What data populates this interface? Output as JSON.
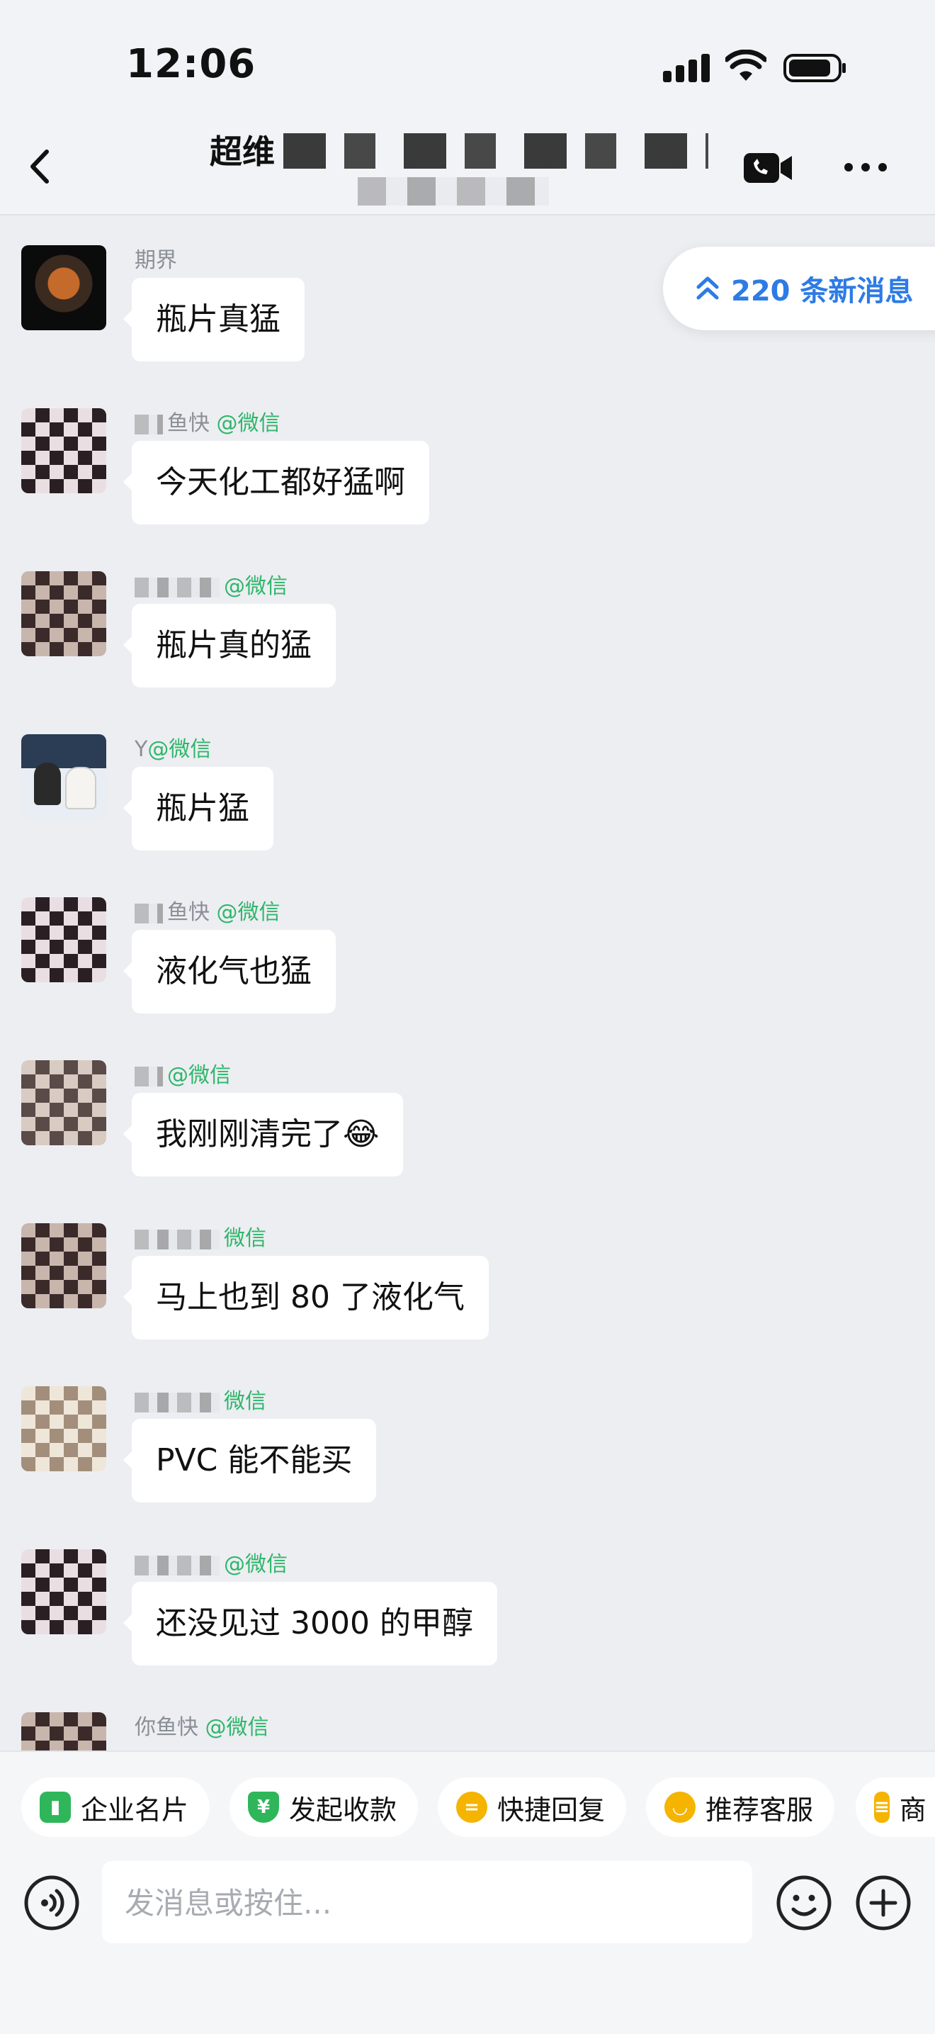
{
  "status_bar": {
    "time": "12:06"
  },
  "header": {
    "title_visible": "超维",
    "back_icon": "chevron-left-icon",
    "video_icon": "video-camera-icon",
    "more_icon": "more-dots-icon"
  },
  "new_messages": {
    "label": "220 条新消息",
    "icon": "double-chevron-up-icon"
  },
  "messages": [
    {
      "sender": "期界",
      "tag": "",
      "text": "瓶片真猛"
    },
    {
      "sender": "鱼快",
      "tag": "@微信",
      "text": "今天化工都好猛啊"
    },
    {
      "sender": "",
      "tag": "@微信",
      "text": "瓶片真的猛"
    },
    {
      "sender": "Y",
      "tag": "@微信",
      "text": "瓶片猛"
    },
    {
      "sender": "鱼快",
      "tag": "@微信",
      "text": "液化气也猛"
    },
    {
      "sender": "",
      "tag": "@微信",
      "text": "我刚刚清完了😂"
    },
    {
      "sender": "",
      "tag": "微信",
      "text": "马上也到 80 了液化气"
    },
    {
      "sender": "",
      "tag": "微信",
      "text": "PVC 能不能买"
    },
    {
      "sender": "",
      "tag": "@微信",
      "text": "还没见过 3000 的甲醇"
    },
    {
      "sender": "你鱼快",
      "tag": "@微信",
      "text": ""
    }
  ],
  "quick_actions": [
    {
      "label": "企业名片",
      "icon": "business-card-icon",
      "color": "#2fb65a"
    },
    {
      "label": "发起收款",
      "icon": "yuan-shield-icon",
      "color": "#2fb65a"
    },
    {
      "label": "快捷回复",
      "icon": "quick-reply-icon",
      "color": "#f5b400"
    },
    {
      "label": "推荐客服",
      "icon": "recommend-service-icon",
      "color": "#f5b400"
    },
    {
      "label": "商",
      "icon": "store-icon",
      "color": "#f5b400"
    }
  ],
  "composer": {
    "placeholder": "发消息或按住..."
  }
}
